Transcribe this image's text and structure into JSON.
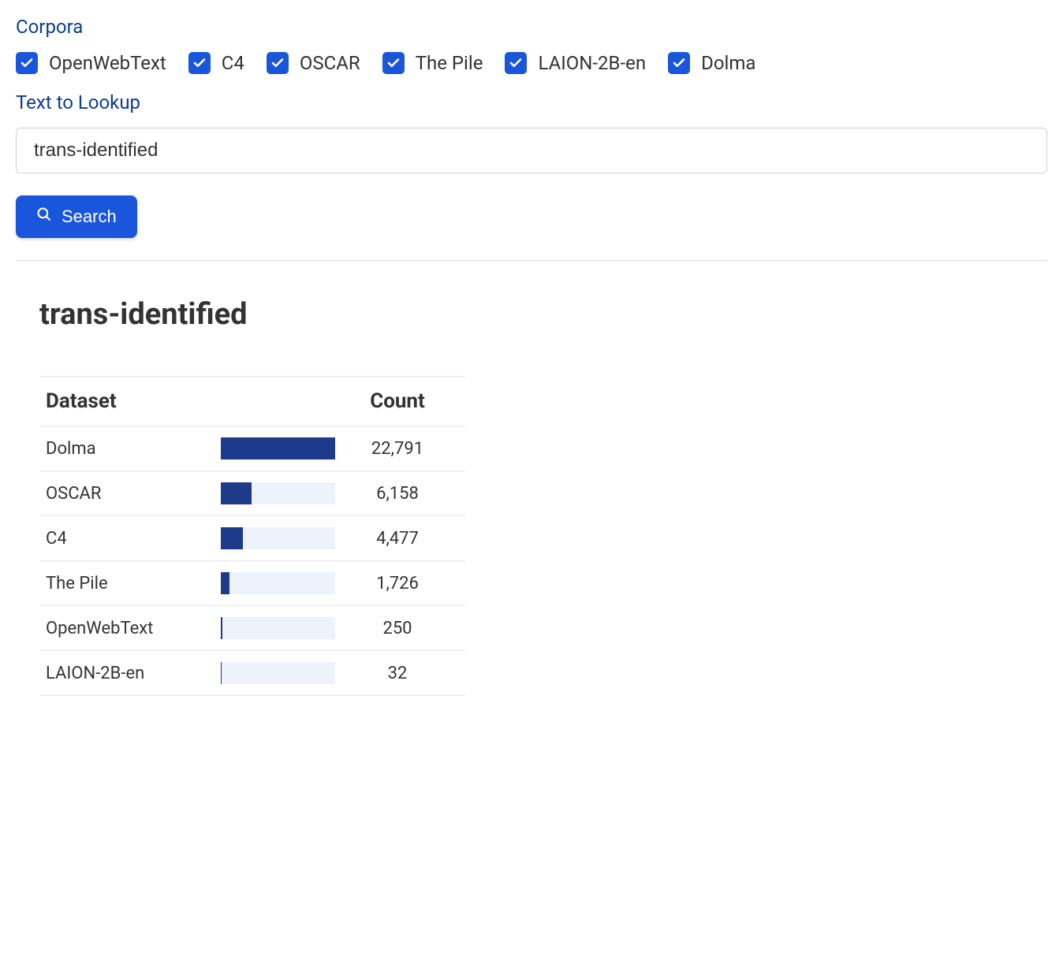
{
  "corpora": {
    "label": "Corpora",
    "items": [
      {
        "label": "OpenWebText",
        "checked": true
      },
      {
        "label": "C4",
        "checked": true
      },
      {
        "label": "OSCAR",
        "checked": true
      },
      {
        "label": "The Pile",
        "checked": true
      },
      {
        "label": "LAION-2B-en",
        "checked": true
      },
      {
        "label": "Dolma",
        "checked": true
      }
    ]
  },
  "lookup": {
    "label": "Text to Lookup",
    "value": "trans-identified"
  },
  "search_button": "Search",
  "result": {
    "title": "trans-identified",
    "columns": {
      "dataset": "Dataset",
      "count": "Count"
    }
  },
  "chart_data": {
    "type": "bar",
    "title": "trans-identified",
    "xlabel": "Count",
    "ylabel": "Dataset",
    "categories": [
      "Dolma",
      "OSCAR",
      "C4",
      "The Pile",
      "OpenWebText",
      "LAION-2B-en"
    ],
    "values": [
      22791,
      6158,
      4477,
      1726,
      250,
      32
    ],
    "display": [
      "22,791",
      "6,158",
      "4,477",
      "1,726",
      "250",
      "32"
    ]
  }
}
